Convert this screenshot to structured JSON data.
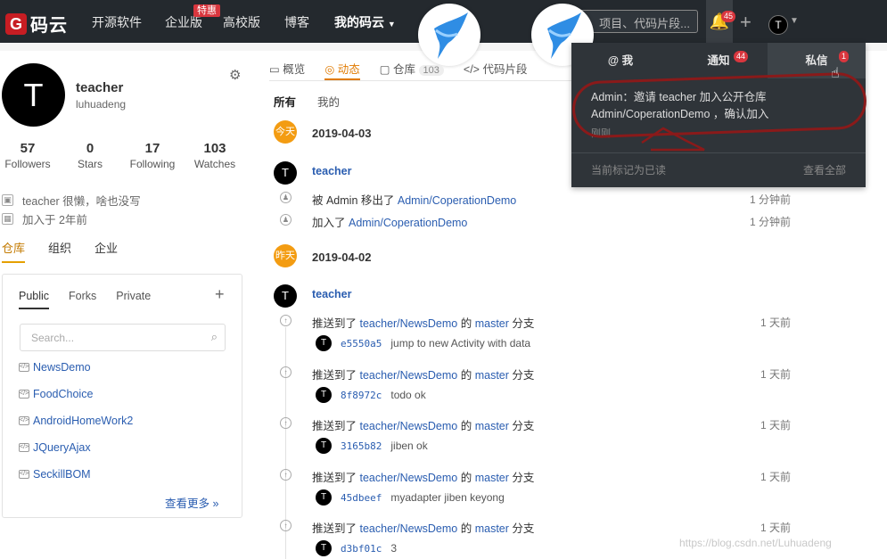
{
  "nav": {
    "logo_text": "码云",
    "items": [
      "开源软件",
      "企业版",
      "高校版",
      "博客"
    ],
    "enterprise_badge": "特惠",
    "my_gitee": "我的码云",
    "search_placeholder": "项目、代码片段...",
    "notification_count": "45",
    "avatar_letter": "T"
  },
  "profile": {
    "avatar_letter": "T",
    "name": "teacher",
    "login": "luhuadeng",
    "stats": [
      {
        "num": "57",
        "label": "Followers"
      },
      {
        "num": "0",
        "label": "Stars"
      },
      {
        "num": "17",
        "label": "Following"
      },
      {
        "num": "103",
        "label": "Watches"
      }
    ],
    "bio": "teacher 很懒，啥也没写",
    "joined": "加入于 2年前"
  },
  "left_tabs": [
    "仓库",
    "组织",
    "企业"
  ],
  "repos": {
    "tabs": [
      "Public",
      "Forks",
      "Private"
    ],
    "search_placeholder": "Search...",
    "items": [
      "NewsDemo",
      "FoodChoice",
      "AndroidHomeWork2",
      "JQueryAjax",
      "SeckillBOM"
    ],
    "more": "查看更多 »"
  },
  "main_tabs": [
    {
      "label": "概览"
    },
    {
      "label": "动态"
    },
    {
      "label": "仓库",
      "count": "103"
    },
    {
      "label": "代码片段"
    }
  ],
  "filters": [
    "所有",
    "我的"
  ],
  "feed": {
    "day1": {
      "badge": "今天",
      "date": "2019-04-03"
    },
    "user1": "teacher",
    "events1": [
      {
        "pre": "被 Admin 移出了 ",
        "link": "Admin/CoperationDemo",
        "post": "",
        "time": "1 分钟前"
      },
      {
        "pre": "加入了 ",
        "link": "Admin/CoperationDemo",
        "post": "",
        "time": "1 分钟前"
      }
    ],
    "day2": {
      "badge": "昨天",
      "date": "2019-04-02"
    },
    "user2": "teacher",
    "push_prefix": "推送到了 ",
    "push_repo": "teacher/NewsDemo",
    "push_mid": " 的 ",
    "push_branch": "master",
    "push_suffix": " 分支",
    "push_time": "1 天前",
    "commits": [
      {
        "sha": "e5550a5",
        "msg": "jump to new Activity with data"
      },
      {
        "sha": "8f8972c",
        "msg": "todo ok"
      },
      {
        "sha": "3165b82",
        "msg": "jiben ok"
      },
      {
        "sha": "45dbeef",
        "msg": "myadapter jiben keyong"
      },
      {
        "sha": "d3bf01c",
        "msg": "3"
      }
    ]
  },
  "notifications": {
    "tabs": [
      {
        "label": "@ 我",
        "badge": ""
      },
      {
        "label": "通知",
        "badge": "44"
      },
      {
        "label": "私信",
        "badge": "1"
      }
    ],
    "message": "Admin：邀请 teacher 加入公开仓库 Admin/CoperationDemo ，确认加入",
    "time": "刚刚",
    "mark_read": "当前标记为已读",
    "view_all": "查看全部"
  },
  "watermark": "https://blog.csdn.net/Luhuadeng"
}
